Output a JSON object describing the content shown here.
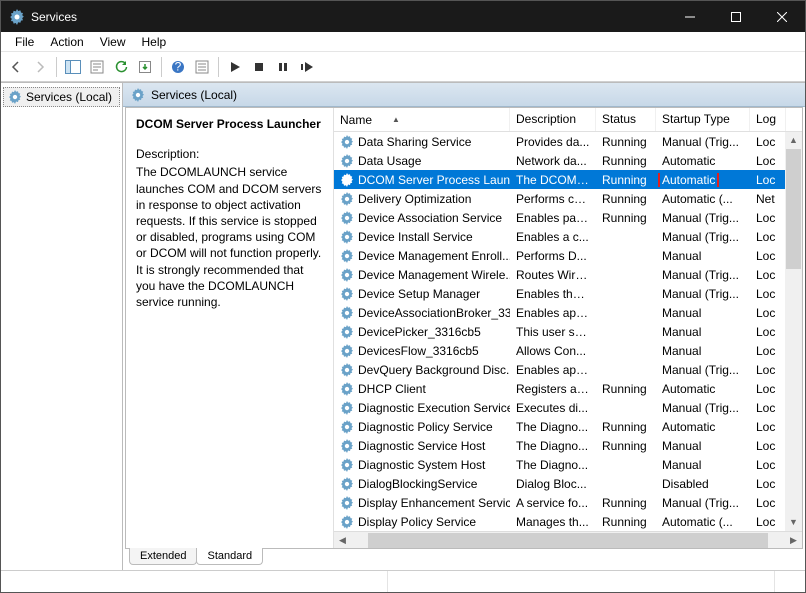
{
  "window": {
    "title": "Services",
    "menus": [
      "File",
      "Action",
      "View",
      "Help"
    ]
  },
  "tree": {
    "root": "Services (Local)"
  },
  "contentHeader": "Services (Local)",
  "detail": {
    "title": "DCOM Server Process Launcher",
    "descLabel": "Description:",
    "description": "The DCOMLAUNCH service launches COM and DCOM servers in response to object activation requests. If this service is stopped or disabled, programs using COM or DCOM will not function properly. It is strongly recommended that you have the DCOMLAUNCH service running."
  },
  "columns": {
    "name": "Name",
    "description": "Description",
    "status": "Status",
    "startup": "Startup Type",
    "logon": "Log"
  },
  "rows": [
    {
      "name": "Data Sharing Service",
      "desc": "Provides da...",
      "status": "Running",
      "startup": "Manual (Trig...",
      "logon": "Loc"
    },
    {
      "name": "Data Usage",
      "desc": "Network da...",
      "status": "Running",
      "startup": "Automatic",
      "logon": "Loc"
    },
    {
      "name": "DCOM Server Process Laun...",
      "desc": "The DCOML...",
      "status": "Running",
      "startup": "Automatic",
      "logon": "Loc",
      "selected": true,
      "highlightStartup": true
    },
    {
      "name": "Delivery Optimization",
      "desc": "Performs co...",
      "status": "Running",
      "startup": "Automatic (...",
      "logon": "Net"
    },
    {
      "name": "Device Association Service",
      "desc": "Enables pair...",
      "status": "Running",
      "startup": "Manual (Trig...",
      "logon": "Loc"
    },
    {
      "name": "Device Install Service",
      "desc": "Enables a c...",
      "status": "",
      "startup": "Manual (Trig...",
      "logon": "Loc"
    },
    {
      "name": "Device Management Enroll...",
      "desc": "Performs D...",
      "status": "",
      "startup": "Manual",
      "logon": "Loc"
    },
    {
      "name": "Device Management Wirele...",
      "desc": "Routes Wire...",
      "status": "",
      "startup": "Manual (Trig...",
      "logon": "Loc"
    },
    {
      "name": "Device Setup Manager",
      "desc": "Enables the ...",
      "status": "",
      "startup": "Manual (Trig...",
      "logon": "Loc"
    },
    {
      "name": "DeviceAssociationBroker_33...",
      "desc": "Enables app...",
      "status": "",
      "startup": "Manual",
      "logon": "Loc"
    },
    {
      "name": "DevicePicker_3316cb5",
      "desc": "This user ser...",
      "status": "",
      "startup": "Manual",
      "logon": "Loc"
    },
    {
      "name": "DevicesFlow_3316cb5",
      "desc": "Allows Con...",
      "status": "",
      "startup": "Manual",
      "logon": "Loc"
    },
    {
      "name": "DevQuery Background Disc...",
      "desc": "Enables app...",
      "status": "",
      "startup": "Manual (Trig...",
      "logon": "Loc"
    },
    {
      "name": "DHCP Client",
      "desc": "Registers an...",
      "status": "Running",
      "startup": "Automatic",
      "logon": "Loc"
    },
    {
      "name": "Diagnostic Execution Service",
      "desc": "Executes di...",
      "status": "",
      "startup": "Manual (Trig...",
      "logon": "Loc"
    },
    {
      "name": "Diagnostic Policy Service",
      "desc": "The Diagno...",
      "status": "Running",
      "startup": "Automatic",
      "logon": "Loc"
    },
    {
      "name": "Diagnostic Service Host",
      "desc": "The Diagno...",
      "status": "Running",
      "startup": "Manual",
      "logon": "Loc"
    },
    {
      "name": "Diagnostic System Host",
      "desc": "The Diagno...",
      "status": "",
      "startup": "Manual",
      "logon": "Loc"
    },
    {
      "name": "DialogBlockingService",
      "desc": "Dialog Bloc...",
      "status": "",
      "startup": "Disabled",
      "logon": "Loc"
    },
    {
      "name": "Display Enhancement Service",
      "desc": "A service fo...",
      "status": "Running",
      "startup": "Manual (Trig...",
      "logon": "Loc"
    },
    {
      "name": "Display Policy Service",
      "desc": "Manages th...",
      "status": "Running",
      "startup": "Automatic (...",
      "logon": "Loc"
    }
  ],
  "tabs": {
    "extended": "Extended",
    "standard": "Standard"
  }
}
